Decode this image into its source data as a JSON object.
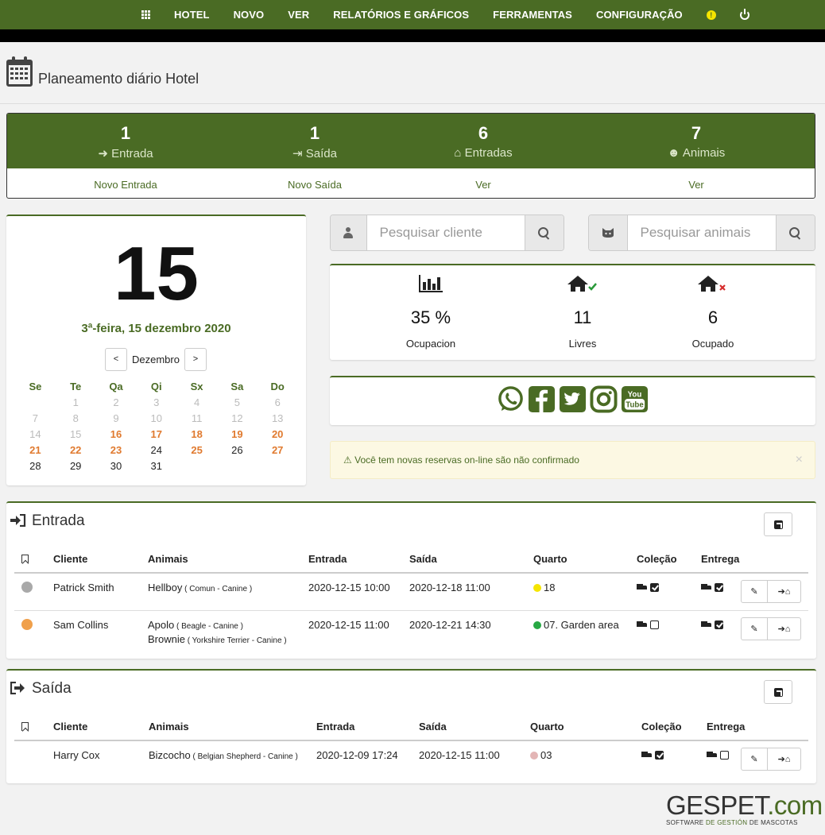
{
  "nav": {
    "items": [
      "HOTEL",
      "NOVO",
      "VER",
      "RELATÓRIOS E GRÁFICOS",
      "FERRAMENTAS",
      "CONFIGURAÇÃO"
    ]
  },
  "page": {
    "title": "Planeamento diário Hotel"
  },
  "stats": [
    {
      "count": "1",
      "label": "Entrada",
      "link": "Novo Entrada",
      "icon": "sign-in-icon"
    },
    {
      "count": "1",
      "label": "Saída",
      "link": "Novo Saída",
      "icon": "sign-out-icon"
    },
    {
      "count": "6",
      "label": "Entradas",
      "link": "Ver",
      "icon": "home-icon"
    },
    {
      "count": "7",
      "label": "Animais",
      "link": "Ver",
      "icon": "cat-icon"
    }
  ],
  "calendar": {
    "day": "15",
    "date_full": "3ª-feira, 15 dezembro 2020",
    "month": "Dezembro",
    "prev": "<",
    "next": ">",
    "weekdays": [
      "Se",
      "Te",
      "Qa",
      "Qi",
      "Sx",
      "Sa",
      "Do"
    ],
    "weeks": [
      [
        [
          "",
          ""
        ],
        [
          "1",
          "past"
        ],
        [
          "2",
          "past"
        ],
        [
          "3",
          "past"
        ],
        [
          "4",
          "past"
        ],
        [
          "5",
          "past"
        ],
        [
          "6",
          "past"
        ]
      ],
      [
        [
          "7",
          "past"
        ],
        [
          "8",
          "past"
        ],
        [
          "9",
          "past"
        ],
        [
          "10",
          "past"
        ],
        [
          "11",
          "past"
        ],
        [
          "12",
          "past"
        ],
        [
          "13",
          "past"
        ]
      ],
      [
        [
          "14",
          "past"
        ],
        [
          "15",
          "past"
        ],
        [
          "16",
          "wk"
        ],
        [
          "17",
          "wk"
        ],
        [
          "18",
          "wk"
        ],
        [
          "19",
          "wk"
        ],
        [
          "20",
          "wk"
        ]
      ],
      [
        [
          "21",
          "wk"
        ],
        [
          "22",
          "wk"
        ],
        [
          "23",
          "wk"
        ],
        [
          "24",
          "norm"
        ],
        [
          "25",
          "wk"
        ],
        [
          "26",
          "norm"
        ],
        [
          "27",
          "wk"
        ]
      ],
      [
        [
          "28",
          "norm"
        ],
        [
          "29",
          "norm"
        ],
        [
          "30",
          "norm"
        ],
        [
          "31",
          "norm"
        ],
        [
          "",
          ""
        ],
        [
          "",
          ""
        ],
        [
          "",
          ""
        ]
      ]
    ]
  },
  "search": {
    "client_placeholder": "Pesquisar cliente",
    "animal_placeholder": "Pesquisar animais"
  },
  "occupancy": [
    {
      "value": "35 %",
      "label": "Ocupacion",
      "icon": "bar-chart-icon"
    },
    {
      "value": "11",
      "label": "Livres",
      "icon": "home-check-icon"
    },
    {
      "value": "6",
      "label": "Ocupado",
      "icon": "home-cross-icon"
    }
  ],
  "social": [
    "whatsapp-icon",
    "facebook-icon",
    "twitter-icon",
    "instagram-icon",
    "youtube-icon"
  ],
  "alert": {
    "text": "Você tem novas reservas on-line são não confirmado",
    "close": "×"
  },
  "entrada": {
    "title": "Entrada",
    "headers": [
      "Cliente",
      "Animais",
      "Entrada",
      "Saída",
      "Quarto",
      "Coleção",
      "Entrega"
    ],
    "rows": [
      {
        "status_color": "#a9a9a9",
        "client": "Patrick Smith",
        "animals": [
          {
            "name": "Hellboy",
            "detail": " ( Comun - Canine )"
          }
        ],
        "entrada": "2020-12-15 10:00",
        "saida": "2020-12-18 11:00",
        "room_color": "#f5e500",
        "room": "18",
        "colecao": true,
        "entrega": true
      },
      {
        "status_color": "#f0a04b",
        "client": "Sam Collins",
        "animals": [
          {
            "name": "Apolo",
            "detail": " ( Beagle - Canine )"
          },
          {
            "name": "Brownie",
            "detail": " ( Yorkshire Terrier - Canine )"
          }
        ],
        "entrada": "2020-12-15 11:00",
        "saida": "2020-12-21 14:30",
        "room_color": "#27a844",
        "room": "07. Garden area",
        "colecao": false,
        "entrega": true
      }
    ]
  },
  "saida": {
    "title": "Saída",
    "headers": [
      "Cliente",
      "Animais",
      "Entrada",
      "Saída",
      "Quarto",
      "Coleção",
      "Entrega"
    ],
    "rows": [
      {
        "client": "Harry Cox",
        "animals": [
          {
            "name": "Bizcocho",
            "detail": " ( Belgian Shepherd - Canine )"
          }
        ],
        "entrada": "2020-12-09 17:24",
        "saida": "2020-12-15 11:00",
        "room_color": "#e3b5b5",
        "room": "03",
        "colecao": true,
        "entrega": false
      }
    ]
  },
  "logo": {
    "part1": "GESPET",
    "part2": ".com",
    "sub1": "SOFTWARE ",
    "sub2": "DE GESTIÓN",
    "sub3": " DE MASCOTAS"
  },
  "colors": {
    "brand": "#4a6b24",
    "weekend": "#e07a2f",
    "alert_bg": "#fcf8e3"
  }
}
